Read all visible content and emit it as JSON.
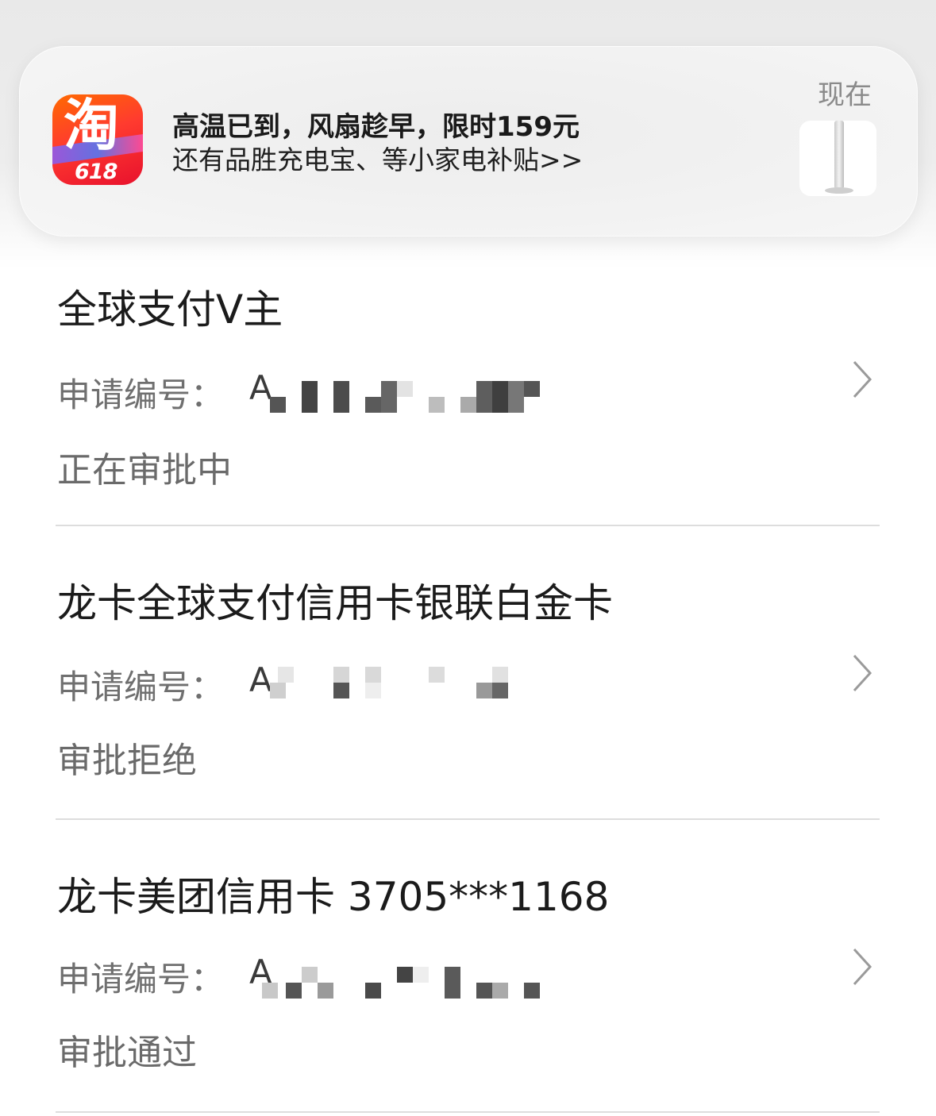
{
  "notification": {
    "app_icon": "taobao-618-app-icon",
    "app_icon_text": "淘",
    "app_icon_badge": "618",
    "title": "高温已到，风扇趁早，限时159元",
    "body": "还有品胜充电宝、等小家电补贴>>",
    "time": "现在",
    "thumbnail": "tower-fan-thumbnail"
  },
  "applications": [
    {
      "title": "全球支付V主",
      "number_label": "申请编号：",
      "number_visible": "A",
      "status": "正在审批中"
    },
    {
      "title": "龙卡全球支付信用卡银联白金卡",
      "number_label": "申请编号：",
      "number_visible": "A",
      "status": "审批拒绝"
    },
    {
      "title": "龙卡美团信用卡 3705***1168",
      "number_label": "申请编号：",
      "number_visible": "A",
      "status": "审批通过"
    }
  ],
  "icons": {
    "chevron": "chevron-right-icon"
  },
  "colors": {
    "title_text": "#1b1b1b",
    "secondary_text": "#6f6f6f",
    "divider": "#dddddd",
    "taobao_orange": "#ff5000"
  }
}
